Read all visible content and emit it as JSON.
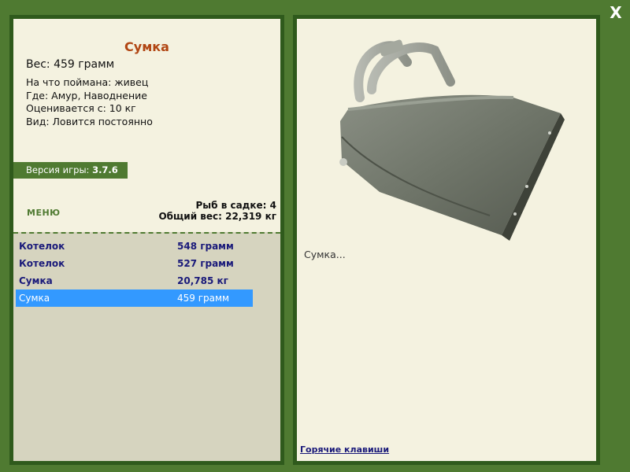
{
  "item": {
    "title": "Сумка",
    "weight_line": "Вес: 459 грамм",
    "caught_on": "На что поймана: живец",
    "where": "Где: Амур, Наводнение",
    "valued_from": "Оценивается с: 10 кг",
    "kind": "Вид: Ловится постоянно",
    "description": "Сумка...",
    "photo_icon": "handbag-photo"
  },
  "version": {
    "label": "Версия игры: ",
    "number": "3.7.6"
  },
  "menu_label": "МЕНЮ",
  "keepnet": {
    "fish_count": "Рыб в садке: 4",
    "total_weight": "Общий вес: 22,319 кг"
  },
  "catch_list": [
    {
      "name": "Котелок",
      "weight": "548 грамм",
      "selected": false
    },
    {
      "name": "Котелок",
      "weight": "527 грамм",
      "selected": false
    },
    {
      "name": "Сумка",
      "weight": "20,785 кг",
      "selected": false
    },
    {
      "name": "Сумка",
      "weight": "459 грамм",
      "selected": true
    }
  ],
  "hotkeys_label": "Горячие клавиши",
  "close_icon": "close-icon",
  "colors": {
    "frame_green": "#4f7a31",
    "dark_green": "#2f5a1c",
    "panel_bg": "#f4f2e0",
    "title_orange": "#b14613",
    "list_text": "#1a1a7a",
    "selection_blue": "#3399ff"
  }
}
